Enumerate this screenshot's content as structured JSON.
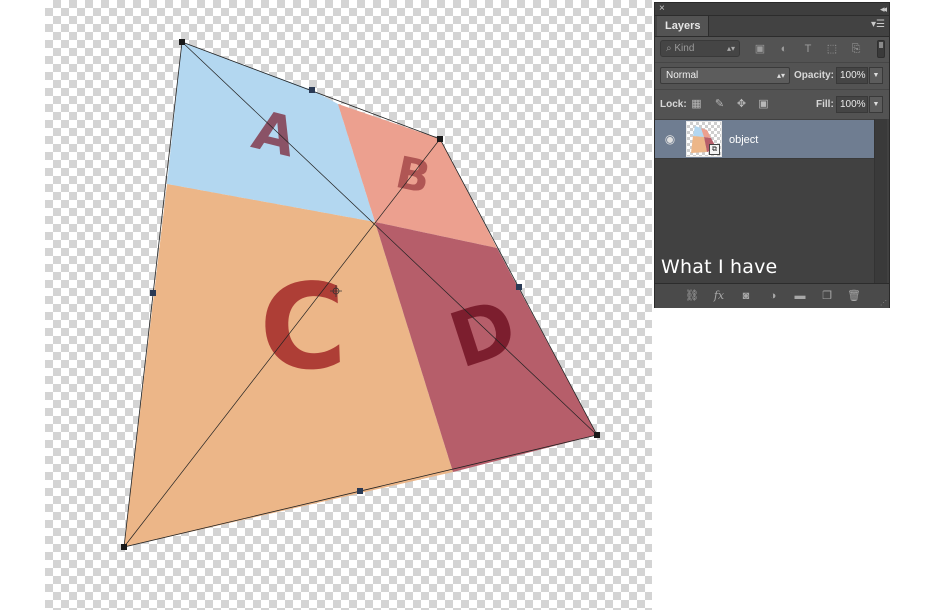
{
  "canvas": {
    "quadrants": [
      {
        "letter": "A",
        "color": "#b3d7f0"
      },
      {
        "letter": "B",
        "color": "#eca08f"
      },
      {
        "letter": "C",
        "color": "#ecb688"
      },
      {
        "letter": "D",
        "color": "#b65e6a"
      }
    ],
    "letter_colors": {
      "A": "#8a5266",
      "B": "#b05654",
      "C": "#ae3e36",
      "D": "#7c1e2e"
    }
  },
  "layers_panel": {
    "tab_label": "Layers",
    "close_glyph": "×",
    "collapse_glyph": "◂◂",
    "menu_glyph": "▾☰",
    "filter": {
      "kind_label": "⌕ Kind",
      "icons": [
        "image-filter-icon",
        "adjustment-filter-icon",
        "type-filter-icon",
        "shape-filter-icon",
        "smart-object-filter-icon"
      ]
    },
    "blend_mode": "Normal",
    "opacity_label": "Opacity:",
    "opacity_value": "100%",
    "lock_label": "Lock:",
    "fill_label": "Fill:",
    "fill_value": "100%",
    "layers": [
      {
        "name": "object",
        "visible": true,
        "selected": true
      }
    ],
    "caption": "What I have",
    "bottom_icons": [
      "link-layers-icon",
      "fx-icon",
      "add-mask-icon",
      "adjustment-layer-icon",
      "new-group-icon",
      "new-layer-icon",
      "trash-icon"
    ]
  }
}
